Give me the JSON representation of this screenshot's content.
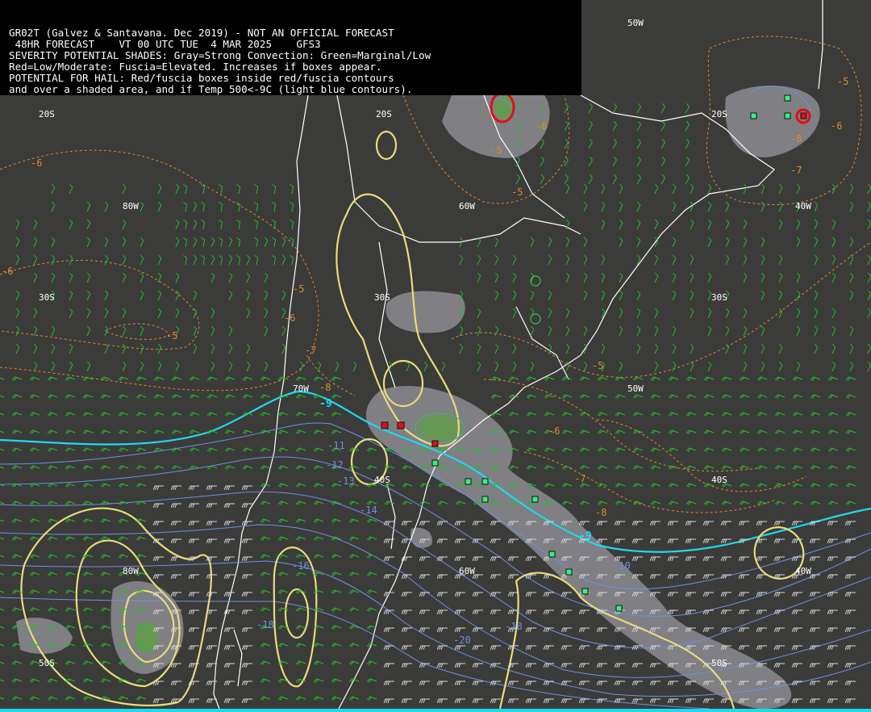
{
  "header": {
    "line1": "GR02T (Galvez & Santavana. Dec 2019) - NOT AN OFFICIAL FORECAST",
    "line2": " 48HR FORECAST    VT 00 UTC TUE  4 MAR 2025    GFS3",
    "line3": "SEVERITY POTENTIAL SHADES: Gray=Strong Convection: Green=Marginal/Low",
    "line4": "Red=Low/Moderate: Fuscia=Elevated. Increases if boxes appear.",
    "line5": "POTENTIAL FOR HAIL: Red/fuscia boxes inside red/fuscia contours",
    "line6": "and over a shaded area, and if Temp 500<-9C (light blue contours)."
  },
  "grid_labels": {
    "lat20_a": "20S",
    "lat20_b": "20S",
    "lat20_c": "20S",
    "lat30_a": "30S",
    "lat30_b": "30S",
    "lat30_c": "30S",
    "lat40_a": "40S",
    "lat40_b": "40S",
    "lat50_a": "50S",
    "lat50_b": "50S",
    "lon80_a": "80W",
    "lon80_b": "80W",
    "lon60_a": "60W",
    "lon60_b": "60W",
    "lon40_a": "40W",
    "lon40_b": "40W",
    "lon50_a": "50W",
    "lon50_b": "50W",
    "lon70": "70W"
  },
  "contour_labels": {
    "or1": "-6",
    "or2": "-5",
    "or3": "-5",
    "or4": "-6",
    "or5": "-7",
    "or6": "-8",
    "or7": "-5",
    "or8": "-6",
    "or9": "-5",
    "or10": "-6",
    "or11": "-7",
    "or12": "-8",
    "or13": "-5",
    "or14": "-6",
    "or15": "-7",
    "or16": "-6",
    "or17": "-8",
    "or18": "-5",
    "bl1": "-11",
    "bl2": "-12",
    "bl3": "-13",
    "bl4": "-14",
    "bl5": "-16",
    "bl6": "-18",
    "bl7": "-20",
    "bl8": "-18",
    "bl9": "-10",
    "cy1": "-9",
    "cy2": "-9"
  },
  "colors": {
    "background": "#3b3b39",
    "coastline": "#ffffff",
    "shade_gray": "#8a8a90",
    "shade_green": "#5fa046",
    "hail_red": "#e01010",
    "box_green": "#36f07a",
    "yellow_contour": "#e8dc7a",
    "orange_contour": "#e08a2a",
    "blue_contour": "#6f8fe6",
    "cyan_contour": "#1fd9ef",
    "wind_barb": "#20c02a"
  }
}
